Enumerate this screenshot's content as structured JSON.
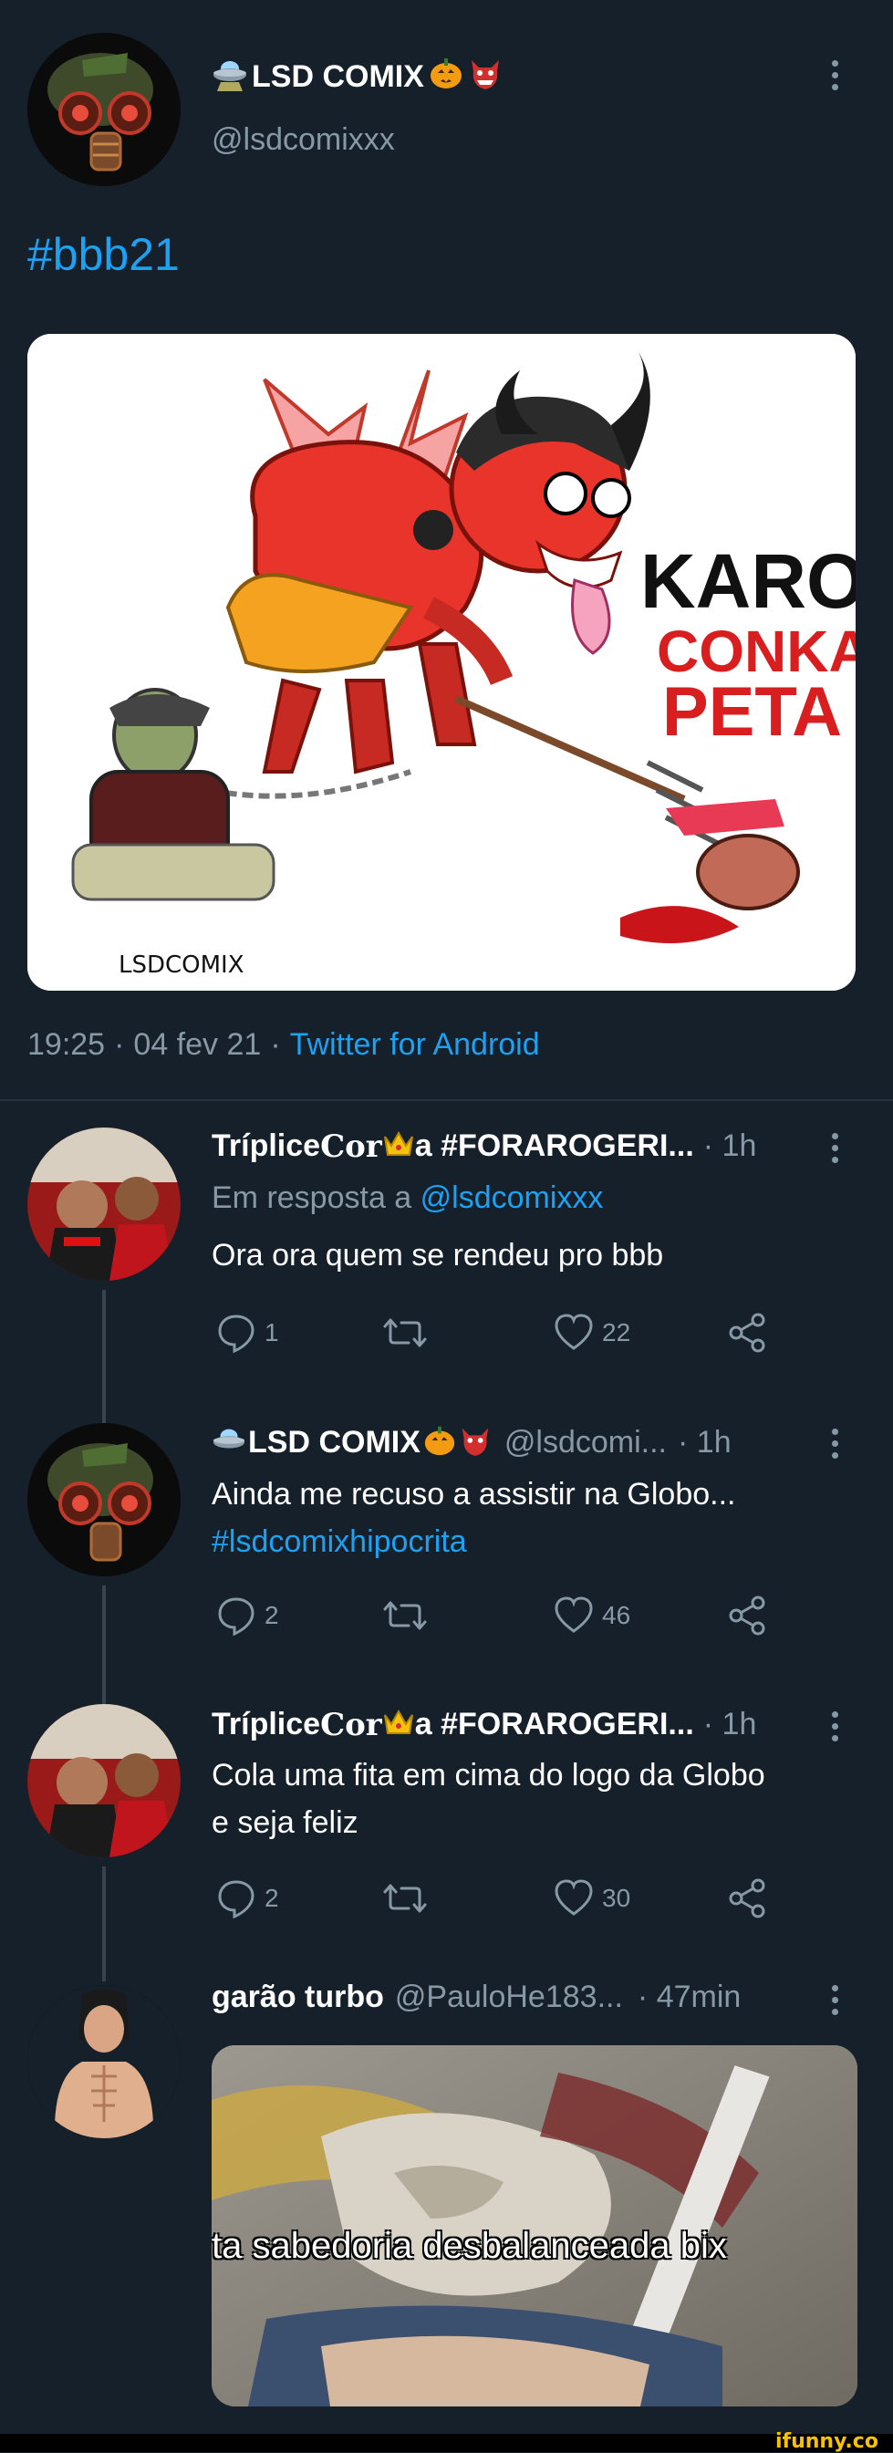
{
  "main_tweet": {
    "author_name": "LSD COMIX",
    "author_handle": "@lsdcomixxx",
    "hashtag": "#bbb21",
    "image": {
      "title_line1": "KAROL",
      "title_line2": "CONKA",
      "title_line3": "PETA",
      "signature": "LSDCOMIX"
    },
    "time": "19:25",
    "date": "04 fev 21",
    "source": "Twitter for Android"
  },
  "replies": [
    {
      "name_pre": "Tríplice ",
      "name_gothic": "Cor",
      "name_post": "a #FORAROGERI...",
      "time": "· 1h",
      "reply_prefix": "Em resposta a",
      "reply_to": "@lsdcomixxx",
      "text": "Ora ora quem se rendeu pro bbb",
      "comments": "1",
      "retweets": "",
      "likes": "22"
    },
    {
      "name": "LSD COMIX",
      "handle": "@lsdcomi...",
      "time": "· 1h",
      "text": "Ainda me recuso a assistir na Globo...",
      "hashtag": "#lsdcomixhipocrita",
      "comments": "2",
      "retweets": "",
      "likes": "46"
    },
    {
      "name_pre": "Tríplice ",
      "name_gothic": "Cor",
      "name_post": "a #FORAROGERI...",
      "time": "· 1h",
      "text_line1": "Cola uma fita em cima do logo da Globo",
      "text_line2": "e seja feliz",
      "comments": "2",
      "retweets": "",
      "likes": "30"
    },
    {
      "name": "garão turbo",
      "handle": "@PauloHe183...",
      "time": "· 47min",
      "media_caption": "ta sabedoria desbalanceada bix"
    }
  ],
  "watermark": "ifunny.co",
  "colors": {
    "background": "#15202b",
    "link": "#1da1f2",
    "muted": "#8899a6"
  }
}
